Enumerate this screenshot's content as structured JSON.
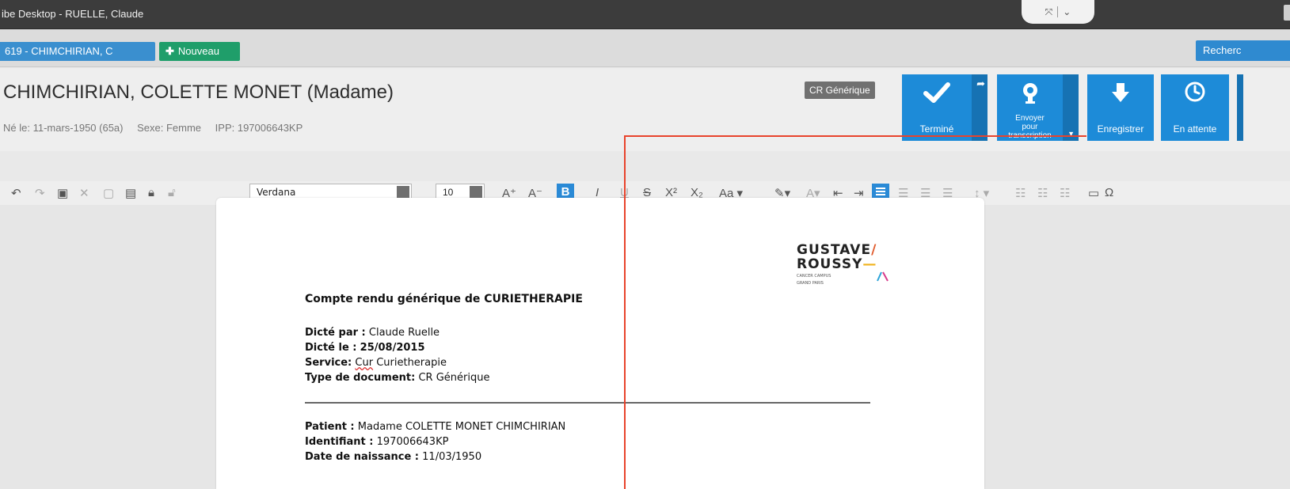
{
  "window": {
    "title": "ibe Desktop - RUELLE, Claude"
  },
  "tabs": {
    "patient_tab": "619 - CHIMCHIRIAN, C",
    "new_tab": "Nouveau",
    "search": "Recherc"
  },
  "header": {
    "patient_name": "CHIMCHIRIAN, COLETTE MONET (Madame)",
    "birth": "Né le: 11-mars-1950 (65a)",
    "sex": "Sexe: Femme",
    "ipp": "IPP: 197006643KP",
    "badge": "CR Générique"
  },
  "actions": {
    "termine": "Terminé",
    "envoyer_l1": "Envoyer",
    "envoyer_l2": "pour",
    "envoyer_l3": "transcription",
    "enregistrer": "Enregistrer",
    "attente": "En attente"
  },
  "toolbar": {
    "font": "Verdana",
    "size": "10"
  },
  "document": {
    "logo_line1": "GUSTAVE",
    "logo_line2": "ROUSSY",
    "logo_sub": "CANCER CAMPUS",
    "logo_sub2": "GRAND PARIS",
    "title": "Compte rendu générique de CURIETHERAPIE",
    "dicte_par_label": "Dicté par :",
    "dicte_par": "Claude Ruelle",
    "dicte_le_label": "Dicté le :",
    "dicte_le": "25/08/2015",
    "service_label": "Service:",
    "service_cur": "Cur",
    "service": "Curietherapie",
    "type_label": "Type de document:",
    "type": "CR Générique",
    "patient_label": "Patient :",
    "patient": "Madame COLETTE MONET CHIMCHIRIAN",
    "identifiant_label": "Identifiant :",
    "identifiant": "197006643KP",
    "naissance_label": "Date de naissance :",
    "naissance": "11/03/1950"
  },
  "colors": {
    "accent_blue": "#1d8bd8",
    "green": "#1f9e6a",
    "annotation_red": "#e8432c"
  }
}
